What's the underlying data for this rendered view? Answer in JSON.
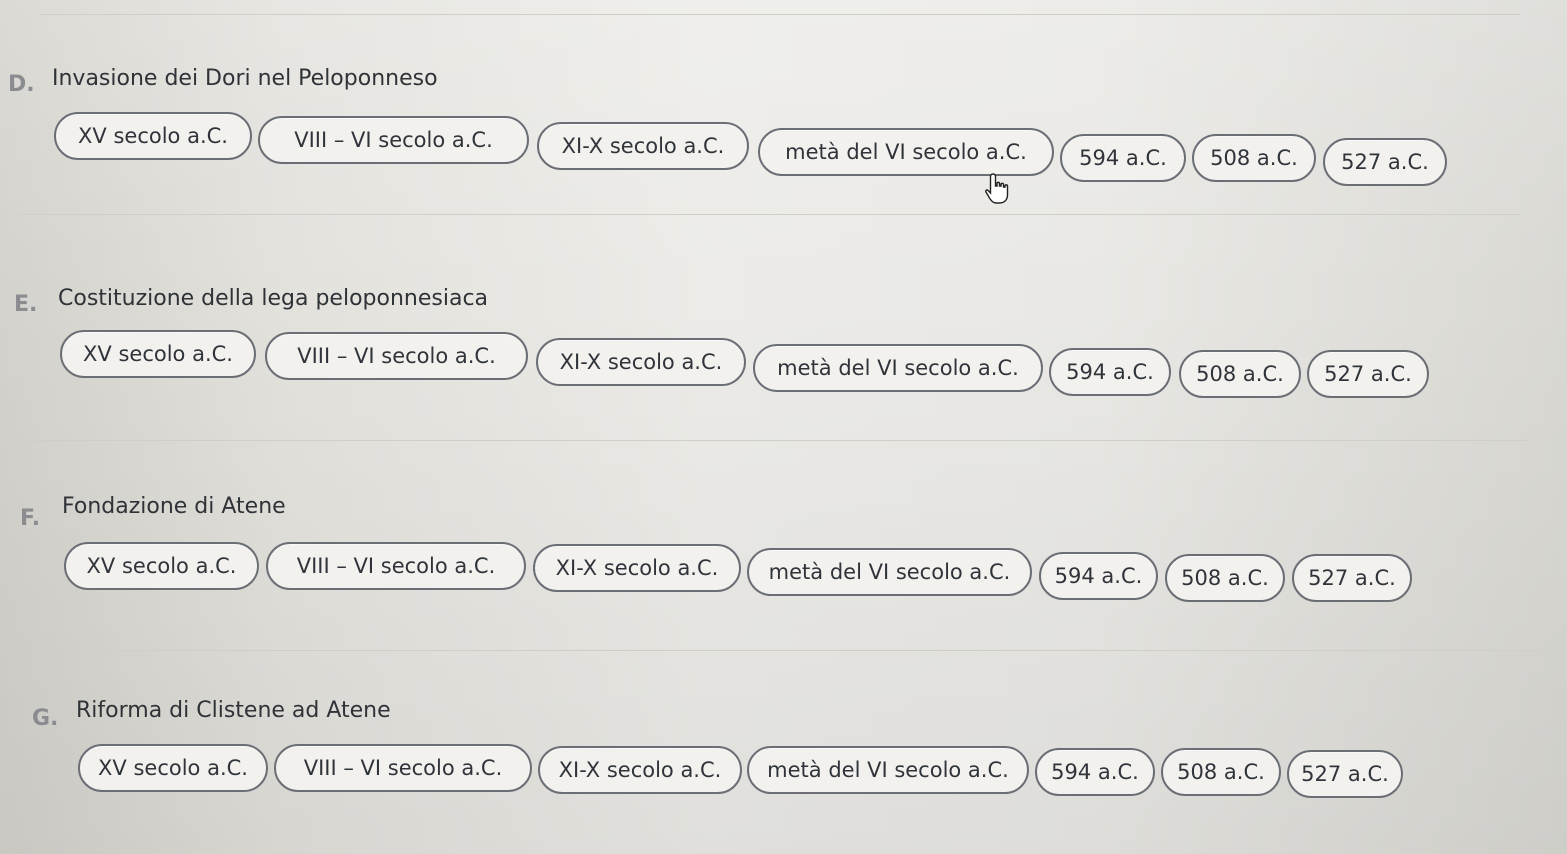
{
  "questions": [
    {
      "letter": "D.",
      "title": "Invasione dei Dori nel Peloponneso",
      "options": [
        "XV secolo a.C.",
        "VIII – VI secolo a.C.",
        "XI-X secolo a.C.",
        "metà del VI secolo a.C.",
        "594 a.C.",
        "508 a.C.",
        "527 a.C."
      ]
    },
    {
      "letter": "E.",
      "title": "Costituzione della lega peloponnesiaca",
      "options": [
        "XV secolo a.C.",
        "VIII – VI secolo a.C.",
        "XI-X secolo a.C.",
        "metà del VI secolo a.C.",
        "594 a.C.",
        "508 a.C.",
        "527 a.C."
      ]
    },
    {
      "letter": "F.",
      "title": "Fondazione di Atene",
      "options": [
        "XV secolo a.C.",
        "VIII – VI secolo a.C.",
        "XI-X secolo a.C.",
        "metà del VI secolo a.C.",
        "594 a.C.",
        "508 a.C.",
        "527 a.C."
      ]
    },
    {
      "letter": "G.",
      "title": "Riforma di Clistene ad Atene",
      "options": [
        "XV secolo a.C.",
        "VIII – VI secolo a.C.",
        "XI-X secolo a.C.",
        "metà del VI secolo a.C.",
        "594 a.C.",
        "508 a.C.",
        "527 a.C."
      ]
    }
  ],
  "cursor_icon": "hand-pointer-icon",
  "colors": {
    "chip_border": "#6b6e74",
    "chip_fill": "#f2f1ee",
    "text": "#2b2f36",
    "letter": "#8a8c90"
  }
}
